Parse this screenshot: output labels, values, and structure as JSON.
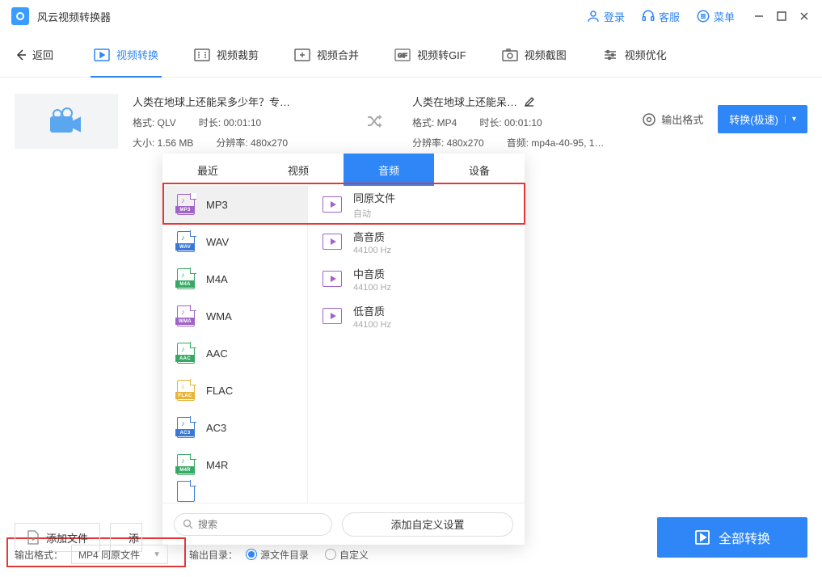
{
  "app": {
    "title": "风云视频转换器"
  },
  "titlebar": {
    "login": "登录",
    "support": "客服",
    "menu": "菜单"
  },
  "nav": {
    "back": "返回",
    "tabs": [
      {
        "label": "视频转换"
      },
      {
        "label": "视频裁剪"
      },
      {
        "label": "视频合并"
      },
      {
        "label": "视频转GIF"
      },
      {
        "label": "视频截图"
      },
      {
        "label": "视频优化"
      }
    ]
  },
  "file": {
    "title_in": "人类在地球上还能呆多少年？专…",
    "format_in_lbl": "格式: QLV",
    "duration_in_lbl": "时长: 00:01:10",
    "size_lbl": "大小: 1.56 MB",
    "res_in_lbl": "分辨率: 480x270",
    "title_out": "人类在地球上还能呆…",
    "format_out_lbl": "格式: MP4",
    "duration_out_lbl": "时长: 00:01:10",
    "res_out_lbl": "分辨率: 480x270",
    "audio_out_lbl": "音频: mp4a-40-95, 1…",
    "output_chip": "输出格式",
    "convert_btn": "转换(极速)"
  },
  "popup": {
    "tabs": [
      "最近",
      "视频",
      "音频",
      "设备"
    ],
    "formats": [
      {
        "label": "MP3",
        "color": "#a064c9",
        "tag": "MP3"
      },
      {
        "label": "WAV",
        "color": "#3a78d8",
        "tag": "WAV"
      },
      {
        "label": "M4A",
        "color": "#37a865",
        "tag": "M4A"
      },
      {
        "label": "WMA",
        "color": "#a064c9",
        "tag": "WMA"
      },
      {
        "label": "AAC",
        "color": "#37a865",
        "tag": "AAC"
      },
      {
        "label": "FLAC",
        "color": "#e8b339",
        "tag": "FLAC"
      },
      {
        "label": "AC3",
        "color": "#3a78d8",
        "tag": "AC3"
      },
      {
        "label": "M4R",
        "color": "#37a865",
        "tag": "M4R"
      }
    ],
    "qualities": [
      {
        "t1": "同原文件",
        "t2": "自动"
      },
      {
        "t1": "高音质",
        "t2": "44100 Hz"
      },
      {
        "t1": "中音质",
        "t2": "44100 Hz"
      },
      {
        "t1": "低音质",
        "t2": "44100 Hz"
      }
    ],
    "search_placeholder": "搜索",
    "custom": "添加自定义设置"
  },
  "bottom": {
    "add_file": "添加文件",
    "add_more": "添",
    "out_fmt_lbl": "输出格式：",
    "out_fmt_val": "MP4 同原文件",
    "out_dir_lbl": "输出目录：",
    "src_dir": "源文件目录",
    "custom_dir": "自定义",
    "all_convert": "全部转换"
  }
}
